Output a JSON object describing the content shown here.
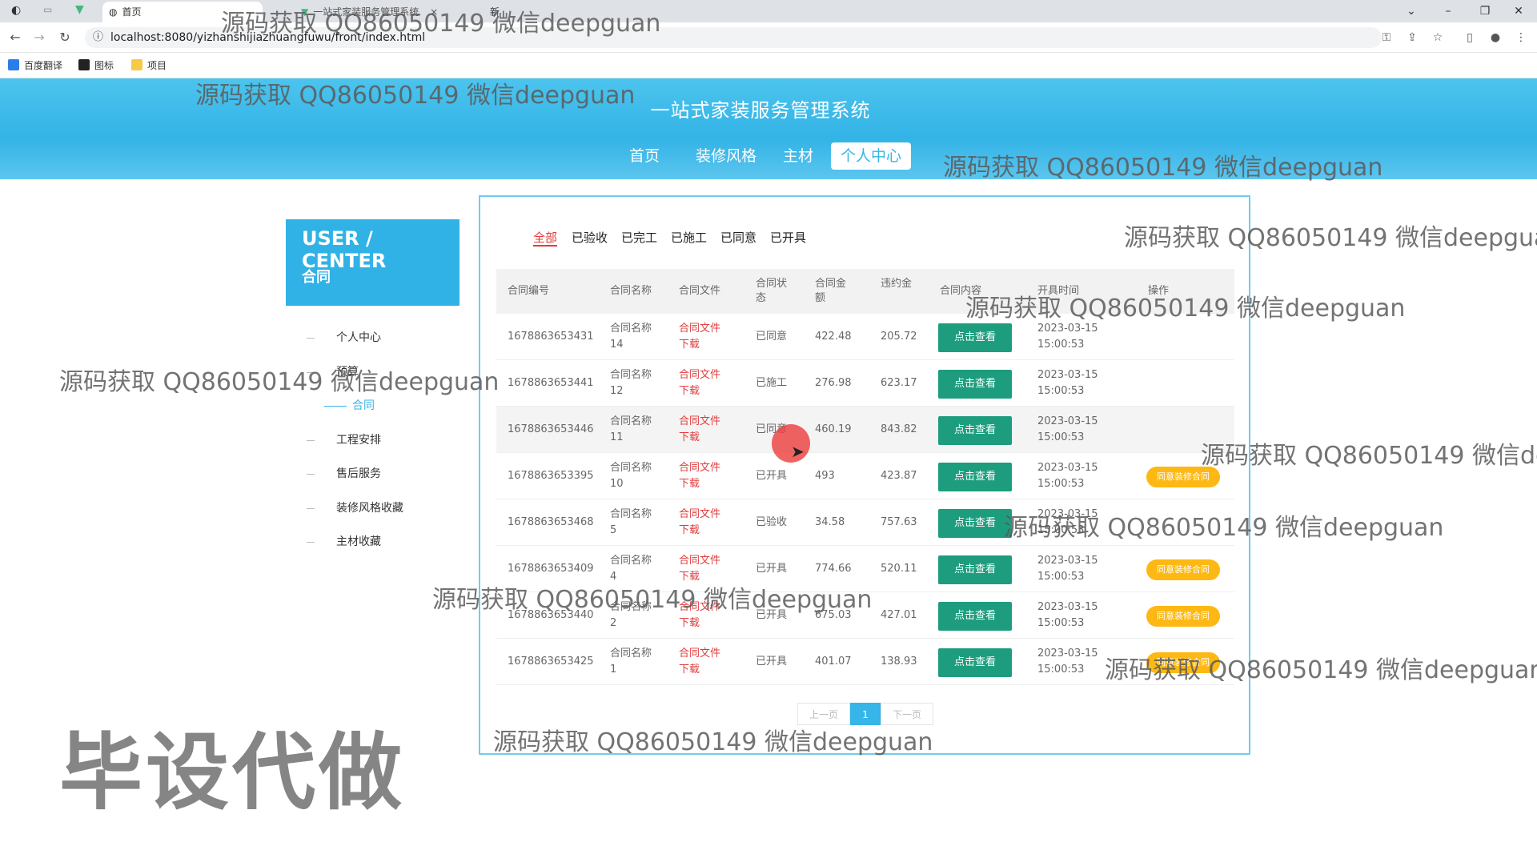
{
  "browser": {
    "tabs": [
      "首页",
      "一站式家装服务管理系统",
      "新"
    ],
    "url": "localhost:8080/yizhanshijiazhuangfuwu/front/index.html",
    "bookmarks": [
      "百度翻译",
      "图标",
      "项目"
    ]
  },
  "site": {
    "title": "一站式家装服务管理系统",
    "nav": [
      "首页",
      "装修风格",
      "主材",
      "个人中心"
    ],
    "active_nav": "个人中心"
  },
  "sidebar": {
    "heading": "USER / CENTER",
    "subheading": "合同",
    "items": [
      "个人中心",
      "预算",
      "合同",
      "工程安排",
      "售后服务",
      "装修风格收藏",
      "主材收藏"
    ],
    "active": "合同"
  },
  "filters": [
    "全部",
    "已验收",
    "已完工",
    "已施工",
    "已同意",
    "已开具"
  ],
  "active_filter": "全部",
  "table": {
    "headers": [
      "合同编号",
      "合同名称",
      "合同文件",
      "合同状态",
      "合同金额",
      "违约金",
      "合同内容",
      "开具时间",
      "操作"
    ],
    "view_label": "点击查看",
    "agree_label": "同意装修合同",
    "file_label": [
      "合同文件",
      "下载"
    ],
    "rows": [
      {
        "id": "1678863653431",
        "name": [
          "合同名称",
          "14"
        ],
        "status": "已同意",
        "amount": "422.48",
        "penalty": "205.72",
        "time": [
          "2023-03-15",
          "15:00:53"
        ],
        "agree": false
      },
      {
        "id": "1678863653441",
        "name": [
          "合同名称",
          "12"
        ],
        "status": "已施工",
        "amount": "276.98",
        "penalty": "623.17",
        "time": [
          "2023-03-15",
          "15:00:53"
        ],
        "agree": false
      },
      {
        "id": "1678863653446",
        "name": [
          "合同名称",
          "11"
        ],
        "status": "已同意",
        "amount": "460.19",
        "penalty": "843.82",
        "time": [
          "2023-03-15",
          "15:00:53"
        ],
        "agree": false
      },
      {
        "id": "1678863653395",
        "name": [
          "合同名称",
          "10"
        ],
        "status": "已开具",
        "amount": "493",
        "penalty": "423.87",
        "time": [
          "2023-03-15",
          "15:00:53"
        ],
        "agree": true
      },
      {
        "id": "1678863653468",
        "name": [
          "合同名称",
          "5"
        ],
        "status": "已验收",
        "amount": "34.58",
        "penalty": "757.63",
        "time": [
          "2023-03-15",
          "15:00:53"
        ],
        "agree": false
      },
      {
        "id": "1678863653409",
        "name": [
          "合同名称",
          "4"
        ],
        "status": "已开具",
        "amount": "774.66",
        "penalty": "520.11",
        "time": [
          "2023-03-15",
          "15:00:53"
        ],
        "agree": true
      },
      {
        "id": "1678863653440",
        "name": [
          "合同名称",
          "2"
        ],
        "status": "已开具",
        "amount": "675.03",
        "penalty": "427.01",
        "time": [
          "2023-03-15",
          "15:00:53"
        ],
        "agree": true
      },
      {
        "id": "1678863653425",
        "name": [
          "合同名称",
          "1"
        ],
        "status": "已开具",
        "amount": "401.07",
        "penalty": "138.93",
        "time": [
          "2023-03-15",
          "15:00:53"
        ],
        "agree": true
      }
    ]
  },
  "pager": {
    "prev": "上一页",
    "current": "1",
    "next": "下一页"
  },
  "watermark": {
    "text": "源码获取 QQ86050149 微信deepguan",
    "big": "毕设代做"
  },
  "colors": {
    "header": "#33b3e6",
    "view_button": "#1d9d7d",
    "agree_button": "#fdb813",
    "accent_red": "#e03c3c"
  }
}
